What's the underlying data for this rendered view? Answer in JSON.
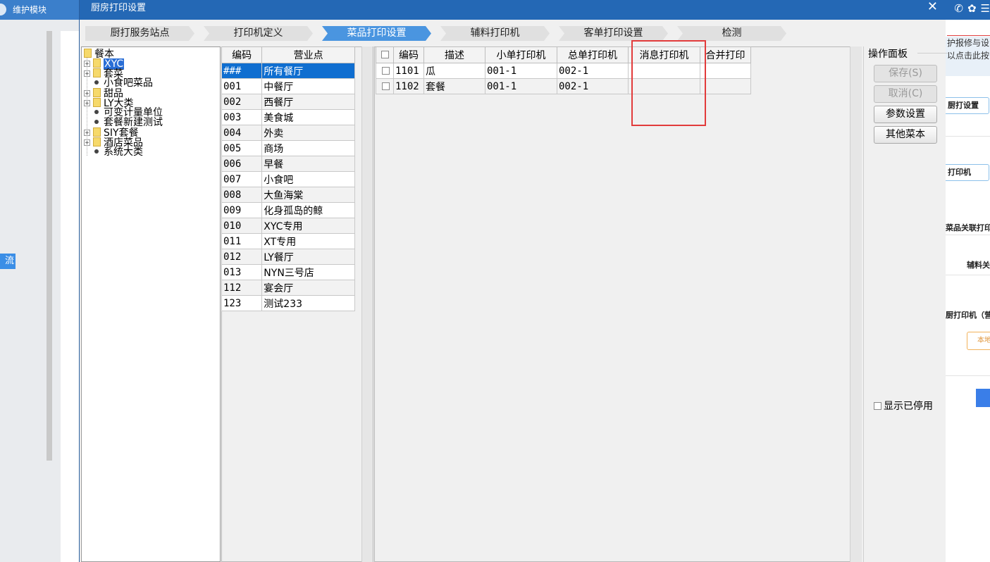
{
  "background": {
    "module_label": "维护模块",
    "flow_tag": "流程",
    "right_notice": [
      "护报修与设",
      "以点击此按"
    ],
    "right_buttons": [
      "厨打设置",
      "打印机",
      "菜品关联打印机",
      "辅料关",
      "厨打印机（营业"
    ],
    "orange_button": "本地"
  },
  "dialog": {
    "title": "厨房打印设置",
    "close_label": "✕"
  },
  "steps": [
    {
      "label": "厨打服务站点",
      "active": false
    },
    {
      "label": "打印机定义",
      "active": false
    },
    {
      "label": "菜品打印设置",
      "active": true
    },
    {
      "label": "辅料打印机",
      "active": false
    },
    {
      "label": "客单打印设置",
      "active": false
    },
    {
      "label": "检测",
      "active": false
    }
  ],
  "tree": {
    "root": "餐本",
    "nodes": [
      {
        "label": "XYC",
        "kind": "folder",
        "selected": true
      },
      {
        "label": "套菜",
        "kind": "folder"
      },
      {
        "label": "小食吧菜品",
        "kind": "leaf"
      },
      {
        "label": "甜品",
        "kind": "folder"
      },
      {
        "label": "LY大类",
        "kind": "folder"
      },
      {
        "label": "可变计量单位",
        "kind": "leaf"
      },
      {
        "label": "套餐新建测试",
        "kind": "leaf"
      },
      {
        "label": "SIY套餐",
        "kind": "folder"
      },
      {
        "label": "酒店菜品",
        "kind": "folder"
      },
      {
        "label": "系统大类",
        "kind": "leaf"
      }
    ]
  },
  "outlets": {
    "headers": [
      "编码",
      "营业点"
    ],
    "rows": [
      [
        "###",
        "所有餐厅"
      ],
      [
        "001",
        "中餐厅"
      ],
      [
        "002",
        "西餐厅"
      ],
      [
        "003",
        "美食城"
      ],
      [
        "004",
        "外卖"
      ],
      [
        "005",
        "商场"
      ],
      [
        "006",
        "早餐"
      ],
      [
        "007",
        "小食吧"
      ],
      [
        "008",
        "大鱼海棠"
      ],
      [
        "009",
        "化身孤岛的鲸"
      ],
      [
        "010",
        "XYC专用"
      ],
      [
        "011",
        "XT专用"
      ],
      [
        "012",
        "LY餐厅"
      ],
      [
        "013",
        "NYN三号店"
      ],
      [
        "112",
        "宴会厅"
      ],
      [
        "123",
        "测试233"
      ]
    ],
    "selected_index": 0
  },
  "dishes": {
    "headers": [
      "编码",
      "描述",
      "小单打印机",
      "总单打印机",
      "消息打印机",
      "合并打印"
    ],
    "rows": [
      [
        "1101",
        "瓜",
        "001-1",
        "002-1",
        "",
        ""
      ],
      [
        "1102",
        "套餐",
        "001-1",
        "002-1",
        "",
        ""
      ]
    ]
  },
  "ops": {
    "title": "操作面板",
    "save_label": "保存(S)",
    "cancel_label": "取消(C)",
    "params_label": "参数设置",
    "other_menu_label": "其他菜本",
    "show_disabled_label": "显示已停用"
  },
  "colors": {
    "titlebar": "#2468b5",
    "active_step": "#4a95e0",
    "selected_row": "#0f6ed0",
    "highlight_box": "#e23b3b"
  }
}
